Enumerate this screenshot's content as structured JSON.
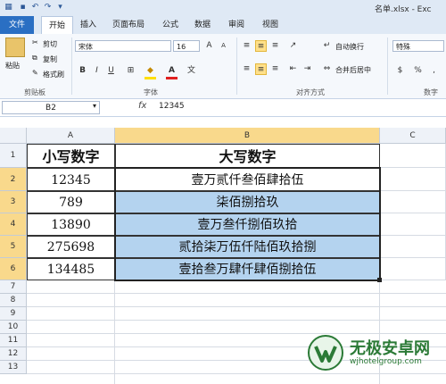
{
  "window": {
    "title": "名单.xlsx - Exc"
  },
  "tabs": [
    {
      "label": "文件"
    },
    {
      "label": "开始"
    },
    {
      "label": "插入"
    },
    {
      "label": "页面布局"
    },
    {
      "label": "公式"
    },
    {
      "label": "数据"
    },
    {
      "label": "审阅"
    },
    {
      "label": "视图"
    }
  ],
  "ribbon": {
    "clipboard": {
      "paste": "粘贴",
      "cut": "剪切",
      "copy": "复制",
      "format_painter": "格式刷",
      "label": "剪贴板"
    },
    "font": {
      "name": "宋体",
      "size": "16",
      "bold": "B",
      "italic": "I",
      "underline": "U",
      "label": "字体"
    },
    "alignment": {
      "wrap": "自动换行",
      "merge": "合并后居中",
      "label": "对齐方式"
    },
    "number": {
      "format": "特殊",
      "label": "数字",
      "percent": "%",
      "comma": ","
    }
  },
  "formula_bar": {
    "name_box": "B2",
    "fx": "fx",
    "value": "12345"
  },
  "columns": [
    {
      "label": "A"
    },
    {
      "label": "B"
    },
    {
      "label": "C"
    }
  ],
  "rows": [
    "1",
    "2",
    "3",
    "4",
    "5",
    "6",
    "7",
    "8",
    "9",
    "10",
    "11",
    "12",
    "13"
  ],
  "table": {
    "header": {
      "a": "小写数字",
      "b": "大写数字"
    },
    "data": [
      {
        "a": "12345",
        "b": "壹万贰仟叁佰肆拾伍"
      },
      {
        "a": "789",
        "b": "柒佰捌拾玖"
      },
      {
        "a": "13890",
        "b": "壹万叁仟捌佰玖拾"
      },
      {
        "a": "275698",
        "b": "贰拾柒万伍仟陆佰玖拾捌"
      },
      {
        "a": "134485",
        "b": "壹拾叁万肆仟肆佰捌拾伍"
      }
    ]
  },
  "watermark": {
    "title": "无极安卓网",
    "url": "wjhotelgroup.com"
  },
  "colors": {
    "selection": "#b4d3ef",
    "accent": "#2a6fc3",
    "header_sel": "#f9d98c",
    "brand_green": "#2b7a36"
  }
}
